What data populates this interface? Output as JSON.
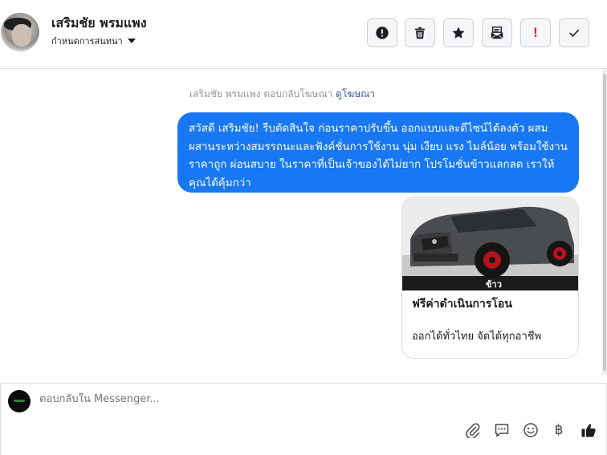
{
  "header": {
    "name": "เสริมชัย พรมแพง",
    "subtitle": "กำหนดการสนทนา"
  },
  "actions": [
    {
      "icon": "alert-circle-icon",
      "kind": "svg"
    },
    {
      "icon": "trash-icon",
      "kind": "svg"
    },
    {
      "icon": "star-icon",
      "kind": "svg"
    },
    {
      "icon": "mark-unread-icon",
      "kind": "svg"
    },
    {
      "icon": "exclamation-icon",
      "kind": "text",
      "text": "!"
    },
    {
      "icon": "check-icon",
      "kind": "svg"
    }
  ],
  "thread": {
    "ad_reply_text": "เสริมชัย พรมแพง ตอบกลับโฆษณา",
    "view_ad_link": "ดูโฆษณา",
    "message": "สวัสดี เสริมชัย! รีบตัดสินใจ ก่อนราคาปรับขึ้น ออกแบบและดีไซน์ได้ลงตัว ผสมผสานระหว่างสมรรถนะและฟังค์ชั่นการใช้งาน นุ่ม เงียบ แรง ไมล์น้อย พร้อมใช้งาน ราคาถูก ผ่อนสบาย ในราคาที่เป็นเจ้าของได้ไม่ยาก โปรโมชั่นข้าวแลกลด เราให้คุณได้คุ้มกว่า",
    "card": {
      "image_caption": "ข้าว",
      "title": "ฟรีค่าดำเนินการโอน",
      "subtitle": "ออกได้ทั่วไทย จัดได้ทุกอาชีพ"
    }
  },
  "composer": {
    "placeholder": "ตอบกลับใน Messenger...",
    "tools": [
      "paperclip-icon",
      "message-template-icon",
      "emoji-icon",
      "baht-icon",
      "thumbs-up-icon"
    ],
    "baht_symbol": "฿"
  },
  "colors": {
    "bubble": "#1877f2",
    "link": "#385898",
    "alert_red": "#e41e3f"
  }
}
